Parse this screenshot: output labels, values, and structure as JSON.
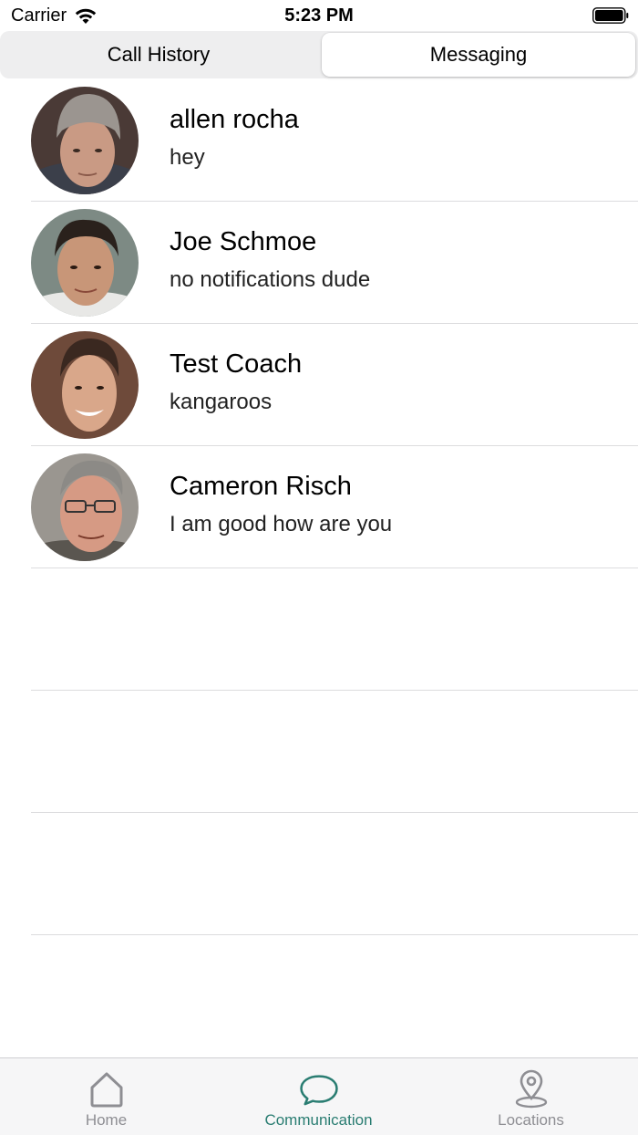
{
  "status_bar": {
    "carrier": "Carrier",
    "time": "5:23 PM"
  },
  "segments": [
    {
      "label": "Call History",
      "selected": false
    },
    {
      "label": "Messaging",
      "selected": true
    }
  ],
  "conversations": [
    {
      "name": "allen rocha",
      "preview": "hey"
    },
    {
      "name": "Joe Schmoe",
      "preview": "no notifications dude"
    },
    {
      "name": "Test Coach",
      "preview": "kangaroos"
    },
    {
      "name": "Cameron Risch",
      "preview": "I am good how are you"
    }
  ],
  "tab_bar": {
    "items": [
      {
        "label": "Home",
        "icon": "home-icon",
        "active": false
      },
      {
        "label": "Communication",
        "icon": "chat-bubble-icon",
        "active": true
      },
      {
        "label": "Locations",
        "icon": "location-pin-icon",
        "active": false
      }
    ]
  },
  "colors": {
    "accent": "#2a7d72",
    "inactive": "#8e8e93",
    "separator": "#dcdcde"
  }
}
